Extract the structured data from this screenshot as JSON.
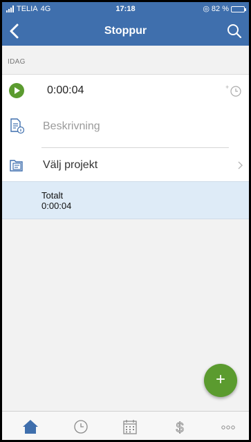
{
  "status_bar": {
    "carrier": "TELIA",
    "network": "4G",
    "time": "17:18",
    "battery": "82 %",
    "battery_level": 0.82
  },
  "nav": {
    "title": "Stoppur",
    "back_icon": "chevron-left-icon",
    "search_icon": "search-icon"
  },
  "section": {
    "header": "IDAG"
  },
  "entry": {
    "timer_value": "0:00:04",
    "description_placeholder": "Beskrivning",
    "project_label": "Välj projekt"
  },
  "total": {
    "label": "Totalt",
    "value": "0:00:04"
  },
  "fab": {
    "label": "+"
  },
  "tabbar": {
    "items": [
      "home-icon",
      "clock-icon",
      "calendar-icon",
      "dollar-icon",
      "more-icon"
    ],
    "more_label": "ooo"
  },
  "colors": {
    "header": "#3f6fad",
    "accent_green": "#5b9b2f",
    "total_bg": "#deebf7",
    "active_tab": "#3f6fad"
  }
}
